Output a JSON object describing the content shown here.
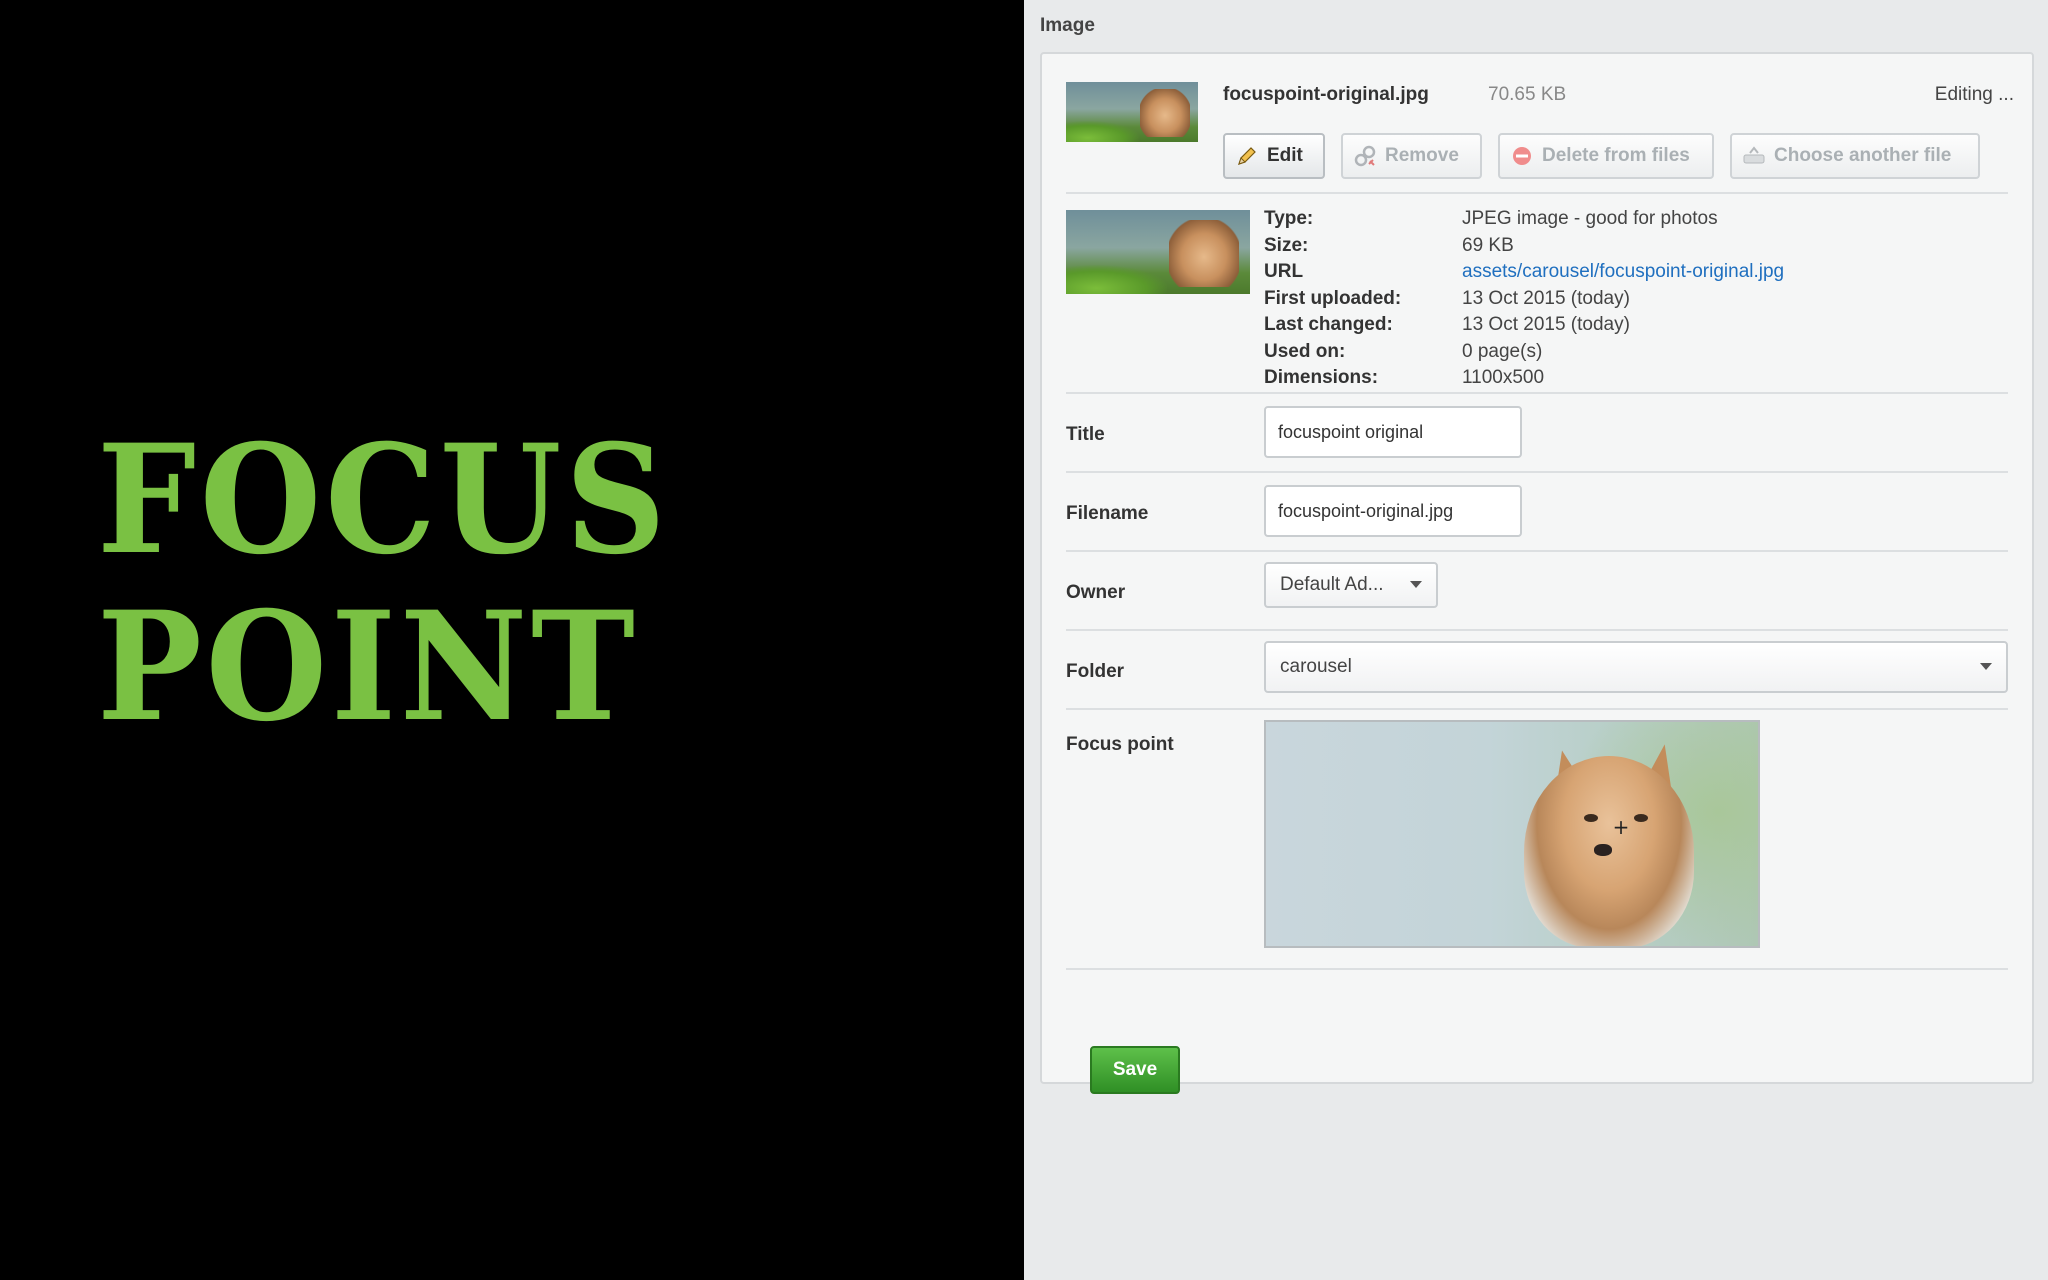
{
  "brand": {
    "line1": "FOCUS",
    "line2": "POINT",
    "color": "#7ac143"
  },
  "panel": {
    "section_label": "Image",
    "file": {
      "name": "focuspoint-original.jpg",
      "size": "70.65 KB",
      "status": "Editing ...",
      "thumbnail": "dog-photo-thumbnail"
    },
    "buttons": {
      "edit": "Edit",
      "remove": "Remove",
      "delete": "Delete from files",
      "choose": "Choose another file"
    },
    "info": [
      {
        "key": "Type:",
        "value": "JPEG image - good for photos"
      },
      {
        "key": "Size:",
        "value": "69 KB"
      },
      {
        "key": "URL",
        "value": "assets/carousel/focuspoint-original.jpg"
      },
      {
        "key": "First uploaded:",
        "value": "13 Oct 2015 (today)"
      },
      {
        "key": "Last changed:",
        "value": "13 Oct 2015 (today)"
      },
      {
        "key": "Used on:",
        "value": "0 page(s)"
      },
      {
        "key": "Dimensions:",
        "value": "1100x500"
      }
    ],
    "fields": {
      "title": {
        "label": "Title",
        "value": "focuspoint original"
      },
      "filename": {
        "label": "Filename",
        "value": "focuspoint-original.jpg"
      },
      "owner": {
        "label": "Owner",
        "value": "Default Ad..."
      },
      "folder": {
        "label": "Folder",
        "value": "carousel"
      },
      "focus_point": {
        "label": "Focus point",
        "marker_icon": "crosshair-icon"
      }
    },
    "save_label": "Save",
    "colors": {
      "link": "#1f6fbf",
      "save": "#3a9a2e"
    }
  }
}
